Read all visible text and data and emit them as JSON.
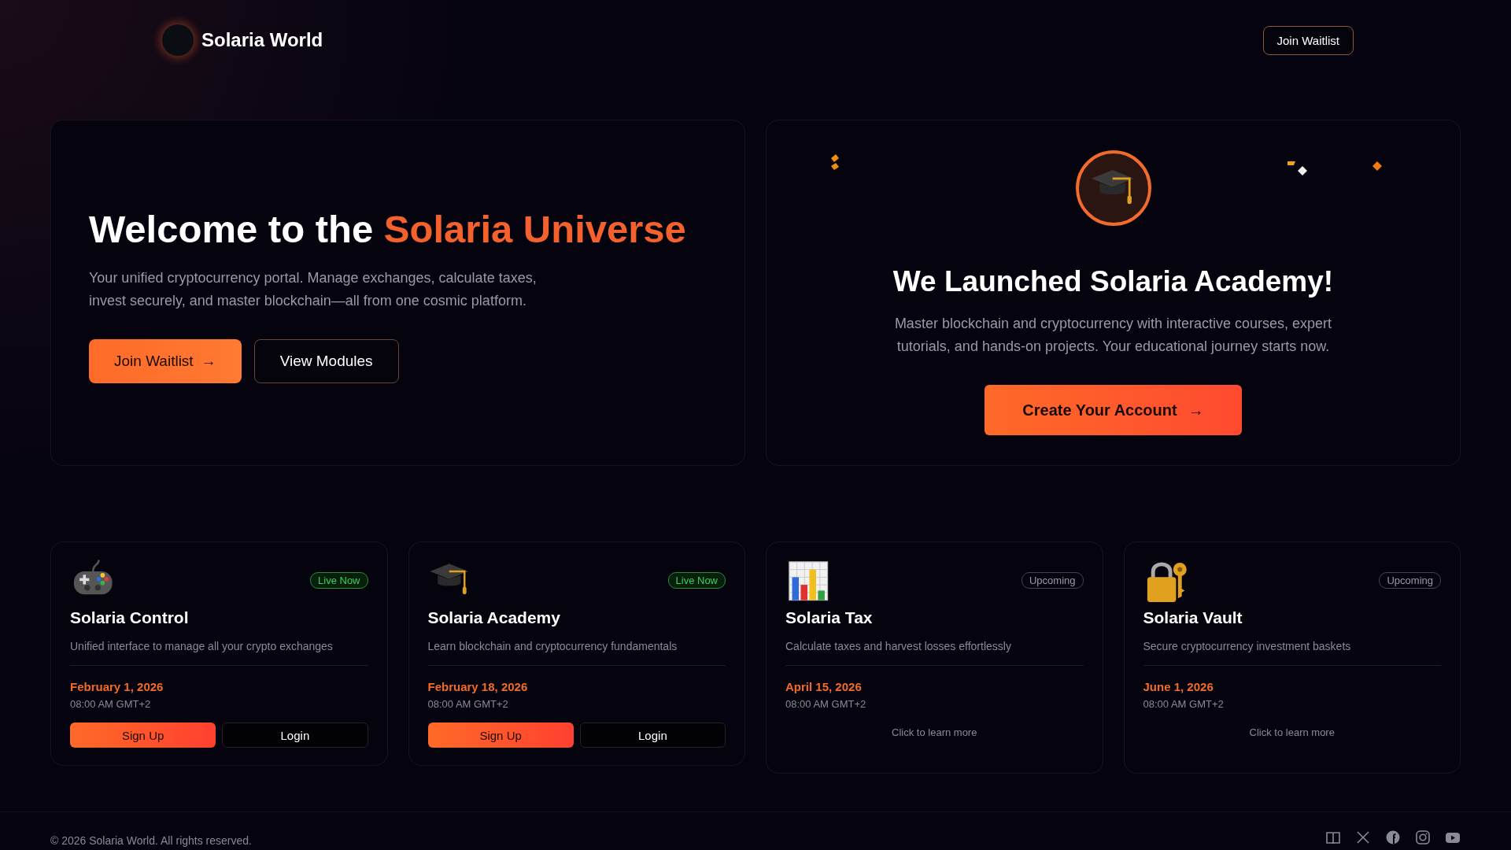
{
  "header": {
    "brand": "Solaria World",
    "button": "Join Waitlist"
  },
  "hero": {
    "title": "Welcome to the ",
    "title_highlight": "Solaria Universe",
    "subtitle": "Your unified cryptocurrency portal. Manage exchanges, calculate taxes, invest securely, and master blockchain—all from one cosmic platform.",
    "primary_button": "Join Waitlist",
    "primary_arrow": "→",
    "secondary_button": "View Modules"
  },
  "announcement": {
    "title": "We Launched Solaria Academy!",
    "description": "Master blockchain and cryptocurrency with interactive courses, expert tutorials, and hands-on projects. Your educational journey starts now.",
    "button": "Create Your Account",
    "button_arrow": "→"
  },
  "modules": [
    {
      "kind": "live",
      "name": "Solaria Control",
      "status": "Live Now",
      "description": "Unified interface to manage all your crypto exchanges",
      "date": "February 1, 2026",
      "time": "08:00 AM GMT+2",
      "buttons": [
        "Sign Up",
        "Login"
      ]
    },
    {
      "kind": "live",
      "name": "Solaria Academy",
      "status": "Live Now",
      "description": "Learn blockchain and cryptocurrency fundamentals",
      "date": "February 18, 2026",
      "time": "08:00 AM GMT+2",
      "buttons": [
        "Sign Up",
        "Login"
      ]
    },
    {
      "kind": "upcoming",
      "name": "Solaria Tax",
      "status": "Upcoming",
      "description": "Calculate taxes and harvest losses effortlessly",
      "date": "April 15, 2026",
      "time": "08:00 AM GMT+2",
      "link": "Click to learn more"
    },
    {
      "kind": "upcoming",
      "name": "Solaria Vault",
      "status": "Upcoming",
      "description": "Secure cryptocurrency investment baskets",
      "date": "June 1, 2026",
      "time": "08:00 AM GMT+2",
      "link": "Click to learn more"
    }
  ],
  "footer": {
    "copyright": "© 2026 Solaria World. All rights reserved."
  }
}
